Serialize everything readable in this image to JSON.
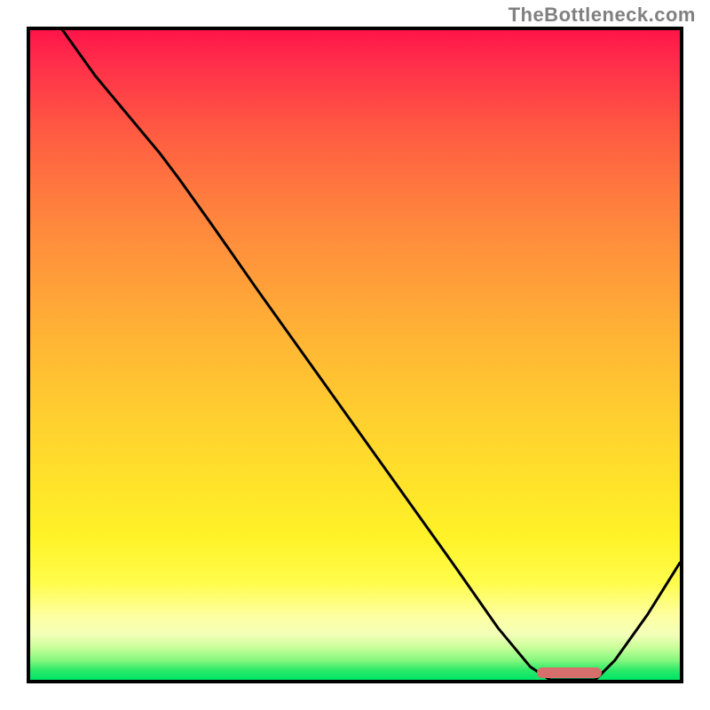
{
  "watermark": "TheBottleneck.com",
  "colors": {
    "curve_stroke": "#000000",
    "marker_fill": "#d66f6b",
    "border": "#000000"
  },
  "chart_data": {
    "type": "line",
    "title": "",
    "xlabel": "",
    "ylabel": "",
    "xlim": [
      0,
      100
    ],
    "ylim": [
      0,
      100
    ],
    "x": [
      0,
      5,
      10,
      15,
      20,
      23,
      28,
      35,
      45,
      55,
      65,
      72,
      77,
      80,
      83,
      87,
      90,
      95,
      100
    ],
    "values": [
      106,
      100,
      93,
      87,
      81,
      77,
      70,
      60,
      46,
      32,
      18,
      8,
      2,
      0,
      0,
      0,
      3,
      10,
      18
    ],
    "optimal_range": {
      "start": 78,
      "end": 88,
      "y": 1.0
    },
    "background_gradient": {
      "direction": "top-to-bottom",
      "stops": [
        {
          "pos": 0,
          "color": "#ff1449"
        },
        {
          "pos": 0.5,
          "color": "#ffb634"
        },
        {
          "pos": 0.85,
          "color": "#fffc4a"
        },
        {
          "pos": 1.0,
          "color": "#00e566"
        }
      ]
    }
  }
}
